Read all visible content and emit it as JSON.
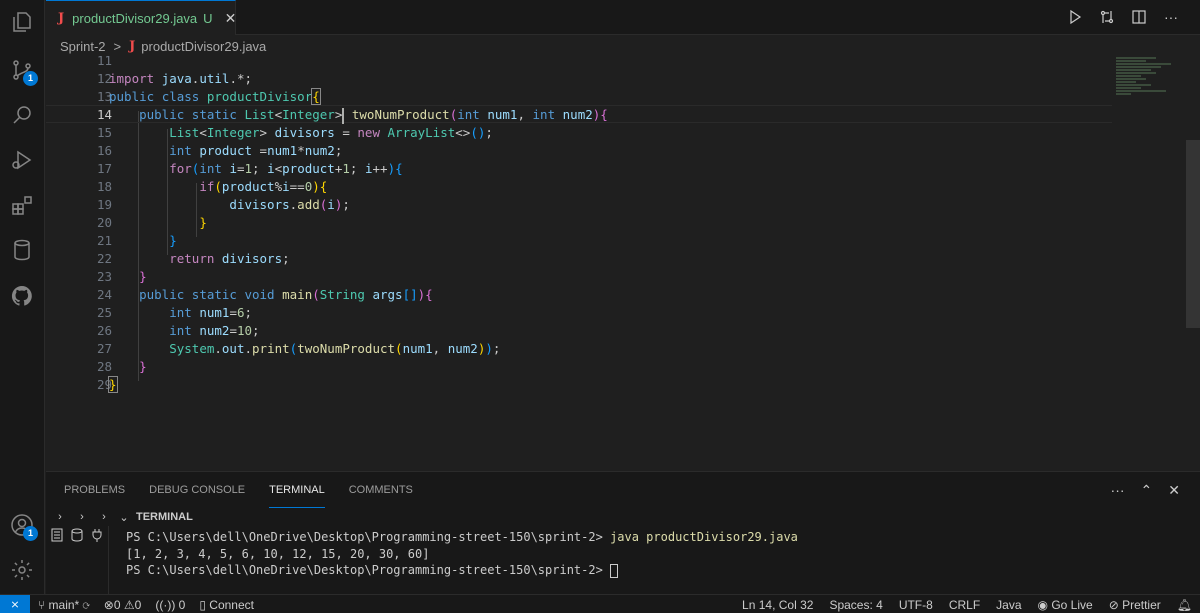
{
  "activity": {
    "badges": {
      "source_control": "1",
      "accounts": "1"
    }
  },
  "tab": {
    "icon": "J",
    "name": "productDivisor29.java",
    "status": "U",
    "close": "✕"
  },
  "breadcrumb": {
    "folder": "Sprint-2",
    "separator": ">",
    "icon": "J",
    "file": "productDivisor29.java"
  },
  "editor": {
    "current_line": 14,
    "line_numbers": [
      "11",
      "12",
      "13",
      "14",
      "15",
      "16",
      "17",
      "18",
      "19",
      "20",
      "21",
      "22",
      "23",
      "24",
      "25",
      "26",
      "27",
      "28",
      "29"
    ]
  },
  "panel": {
    "tabs": [
      "PROBLEMS",
      "DEBUG CONSOLE",
      "TERMINAL",
      "COMMENTS"
    ],
    "active_tab": "TERMINAL",
    "terminal_title": "TERMINAL",
    "actions": {
      "more": "···",
      "maximize": "⌃",
      "close": "✕"
    },
    "terminal_lines": {
      "prompt1": "PS C:\\Users\\dell\\OneDrive\\Desktop\\Programming-street-150\\sprint-2> ",
      "cmd1": "java productDivisor29.java",
      "output": "[1, 2, 3, 4, 5, 6, 10, 12, 15, 20, 30, 60]",
      "prompt2": "PS C:\\Users\\dell\\OneDrive\\Desktop\\Programming-street-150\\sprint-2> "
    }
  },
  "statusbar": {
    "remote": "⨯",
    "branch": "main*",
    "errors": "0",
    "warnings": "0",
    "ports": "0",
    "connect": "Connect",
    "position": "Ln 14, Col 32",
    "spaces": "Spaces: 4",
    "encoding": "UTF-8",
    "eol": "CRLF",
    "language": "Java",
    "golive": "Go Live",
    "prettier": "Prettier"
  },
  "colors": {
    "accent": "#0078d4",
    "java_icon": "#f14c4c",
    "untracked": "#73c991"
  }
}
